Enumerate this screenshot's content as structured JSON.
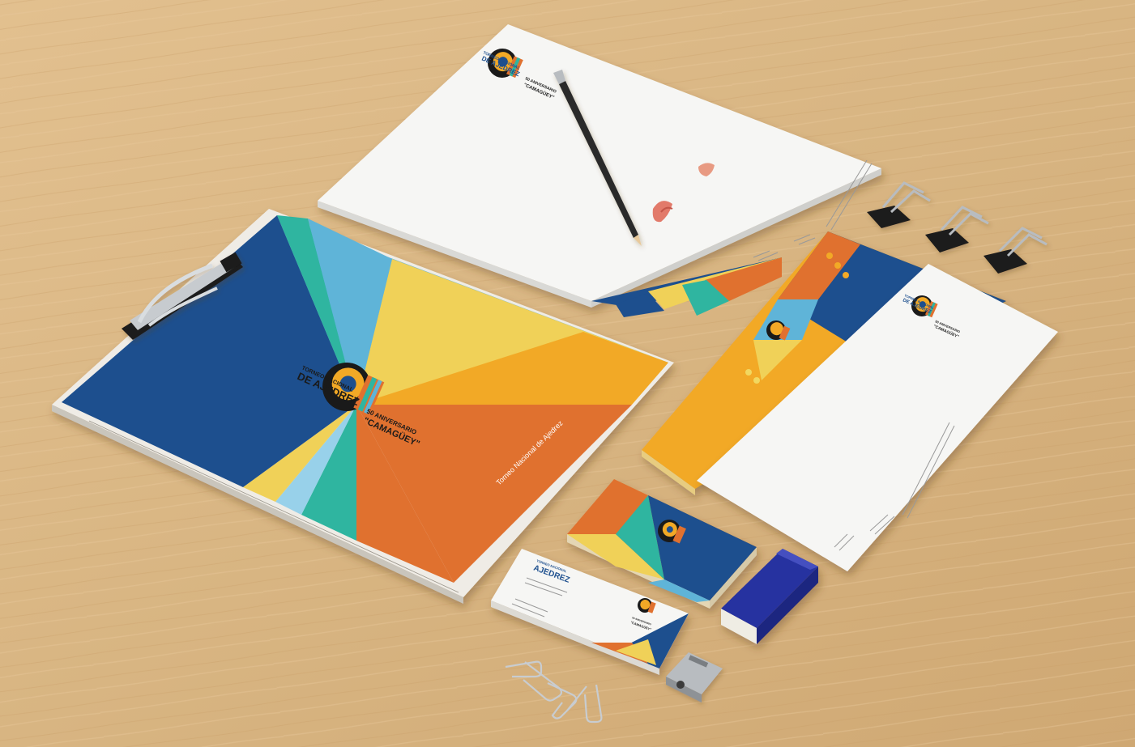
{
  "scene": {
    "background": "#d9b683",
    "palette": {
      "navy": "#1d4f8e",
      "sky": "#5fb4d8",
      "yellow": "#f0d158",
      "orange": "#e0712f",
      "amber": "#f2a926",
      "teal": "#2fb5a0",
      "paper": "#f4f4f2",
      "clip_metal": "#b8bcc0",
      "clip_black": "#1a1a1a"
    }
  },
  "clipboard_sheet": {
    "headline_top": "TORNEO NACIONAL",
    "headline_main": "DE AJEDREZ",
    "subtitle": "50 ANIVERSARIO",
    "city": "\"CAMAGÜEY\"",
    "footer_text": "Torneo Nacional de Ajedrez"
  },
  "letterhead": {
    "headline_top": "TORNEO NACIONAL",
    "headline_main": "DE AJEDREZ",
    "subtitle": "50 ANIVERSARIO",
    "city": "\"CAMAGÜEY\""
  },
  "envelope": {
    "headline_top": "TORNEO NACIONAL",
    "headline_main": "DE AJEDREZ",
    "subtitle": "50 ANIVERSARIO",
    "city": "\"CAMAGÜEY\""
  },
  "business_card": {
    "headline_top": "TORNEO NACIONAL",
    "headline_main": "AJEDREZ",
    "subtitle": "50 ANIVERSARIO",
    "city": "\"CAMAGÜEY\""
  }
}
